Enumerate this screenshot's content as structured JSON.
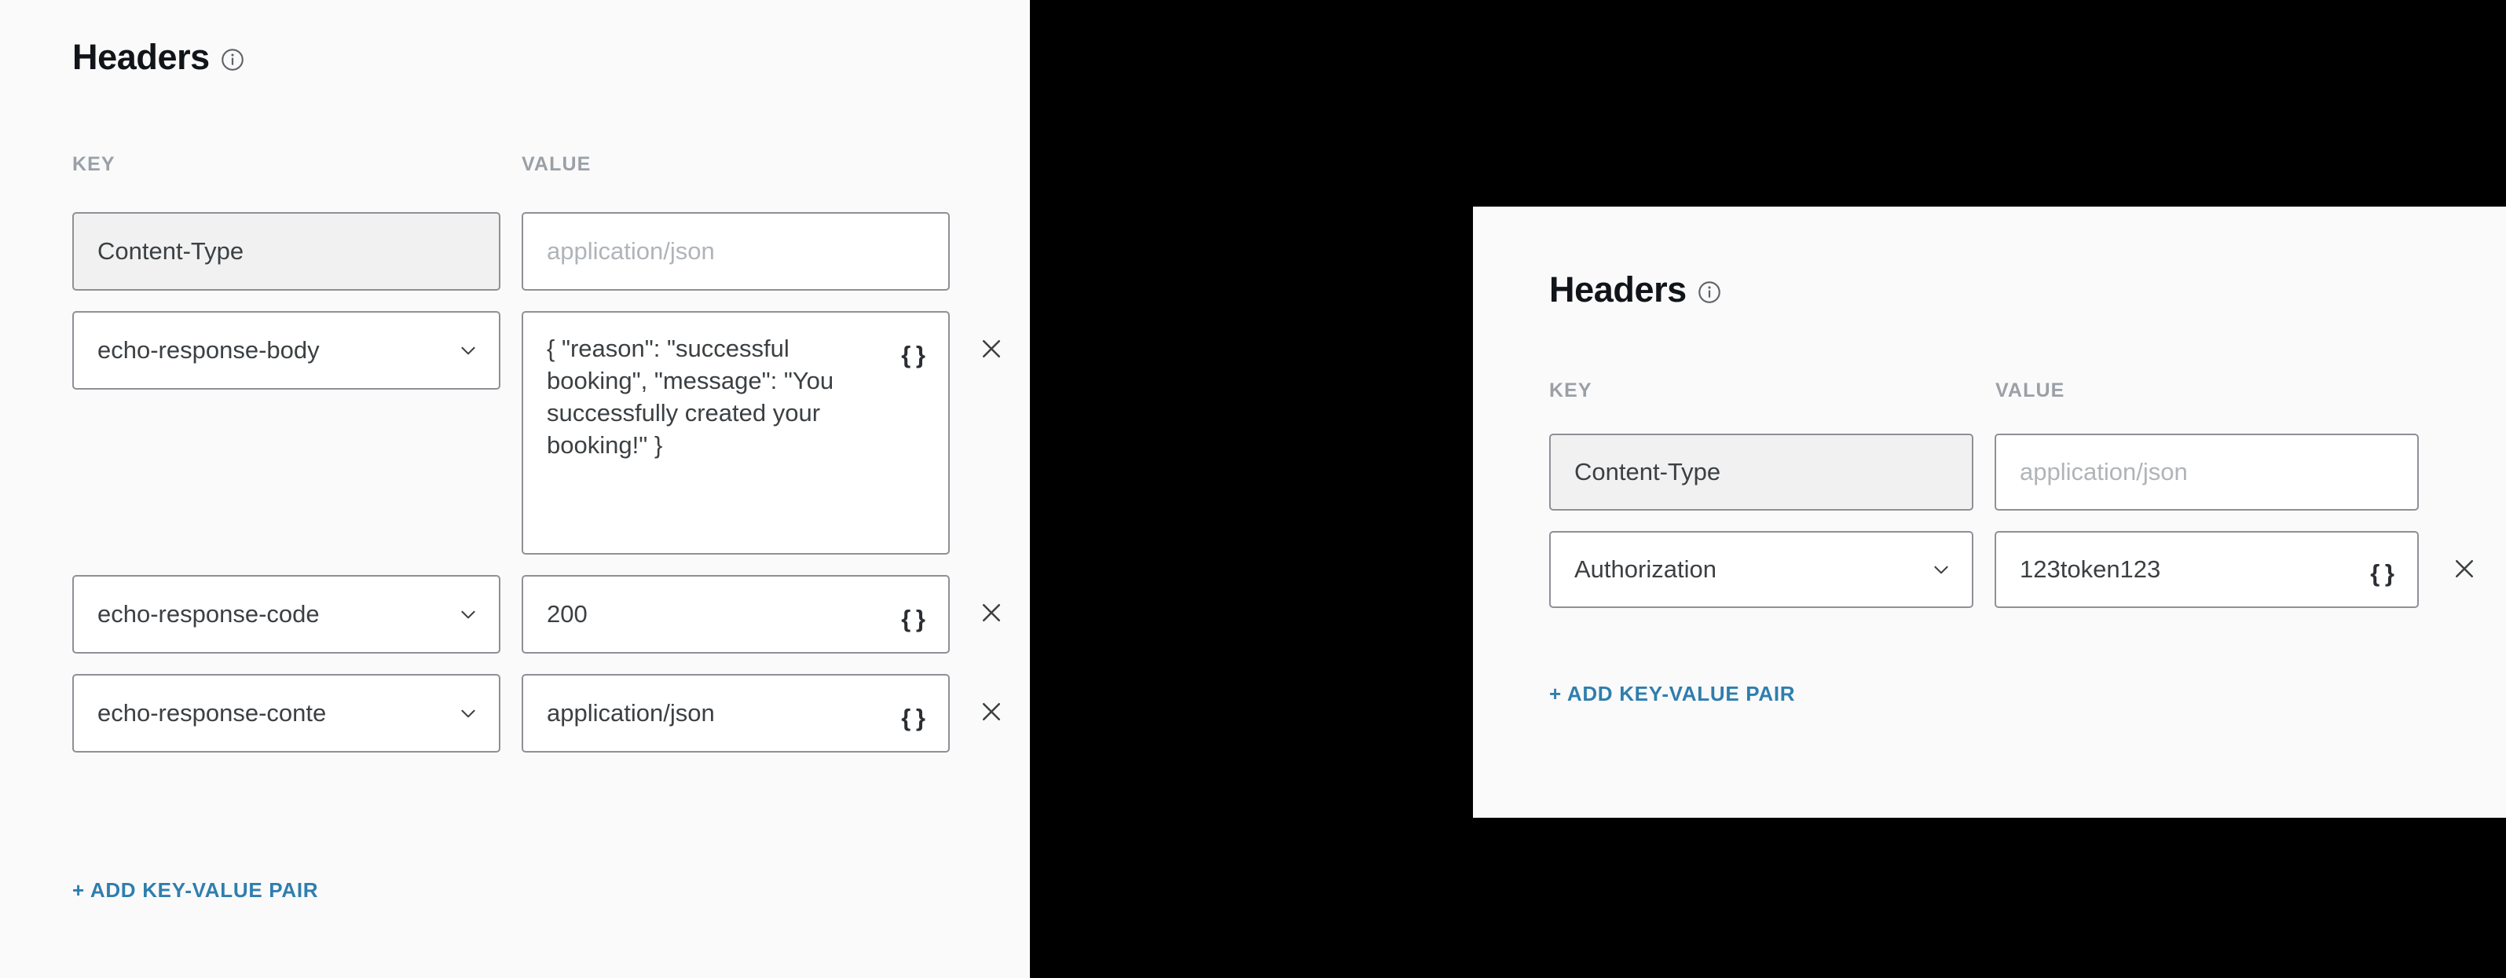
{
  "colors": {
    "panel_bg": "#fafafa",
    "backdrop": "#000000",
    "link": "#2f7eae",
    "label": "#9aa0a6",
    "field_border": "#8d9196",
    "readonly_bg": "#f1f1f1",
    "text": "#3c4043"
  },
  "left_panel": {
    "title": "Headers",
    "info_icon": "info-circle-icon",
    "columns": {
      "key": "KEY",
      "value": "VALUE"
    },
    "add_link": "+ ADD KEY-VALUE PAIR",
    "rows": [
      {
        "key": {
          "type": "input",
          "value": "Content-Type",
          "readonly": true
        },
        "value": {
          "type": "input",
          "value": "",
          "placeholder": "application/json",
          "braces": ""
        },
        "removable": false
      },
      {
        "key": {
          "type": "select",
          "value": "echo-response-body",
          "chevron": "chevron-down-icon"
        },
        "value": {
          "type": "textarea",
          "value": "{ \"reason\": \"successful booking\", \"message\": \"You successfully created your booking!\" }",
          "braces": "{ }"
        },
        "removable": true,
        "remove_icon": "close-icon"
      },
      {
        "key": {
          "type": "select",
          "value": "echo-response-code",
          "chevron": "chevron-down-icon"
        },
        "value": {
          "type": "input",
          "value": "200",
          "braces": "{ }"
        },
        "removable": true,
        "remove_icon": "close-icon"
      },
      {
        "key": {
          "type": "select",
          "value": "echo-response-conte",
          "chevron": "chevron-down-icon"
        },
        "value": {
          "type": "input",
          "value": "application/json",
          "braces": "{ }"
        },
        "removable": true,
        "remove_icon": "close-icon"
      }
    ]
  },
  "right_panel": {
    "title": "Headers",
    "info_icon": "info-circle-icon",
    "columns": {
      "key": "KEY",
      "value": "VALUE"
    },
    "add_link": "+ ADD KEY-VALUE PAIR",
    "rows": [
      {
        "key": {
          "type": "input",
          "value": "Content-Type",
          "readonly": true
        },
        "value": {
          "type": "input",
          "value": "",
          "placeholder": "application/json",
          "braces": ""
        },
        "removable": false
      },
      {
        "key": {
          "type": "select",
          "value": "Authorization",
          "chevron": "chevron-down-icon"
        },
        "value": {
          "type": "input",
          "value": "123token123",
          "braces": "{ }"
        },
        "removable": true,
        "remove_icon": "close-icon"
      }
    ]
  }
}
